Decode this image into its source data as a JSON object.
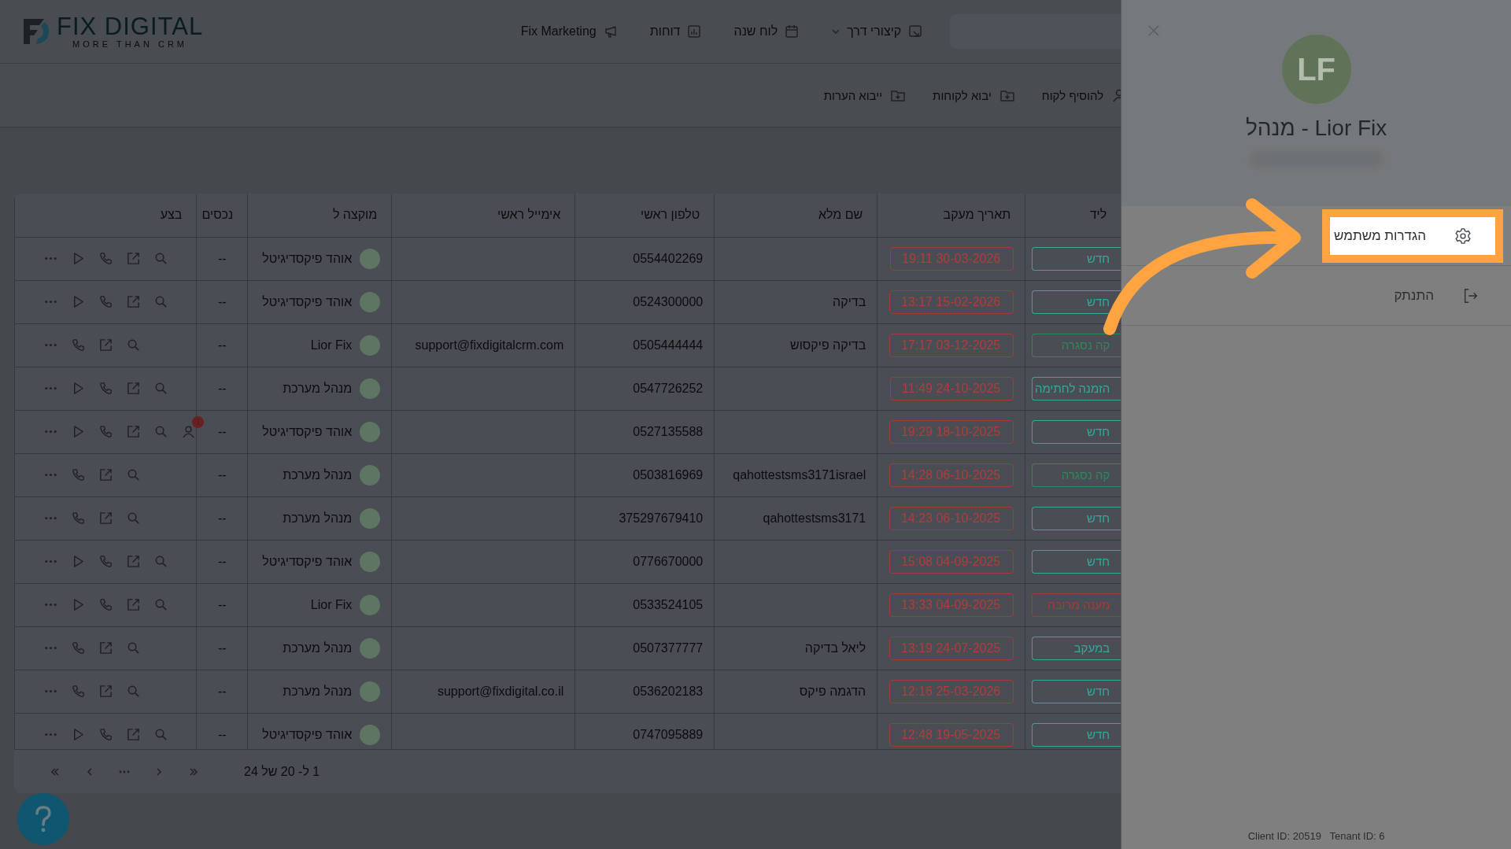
{
  "header": {
    "logo": {
      "name": "FIX DIGITAL",
      "tagline": "MORE THAN CRM"
    },
    "nav": [
      {
        "label": "קיצורי דרך",
        "kind": "dropdown"
      },
      {
        "label": "לוח שנה",
        "kind": "link"
      },
      {
        "label": "דוחות",
        "kind": "link"
      },
      {
        "label": "Fix Marketing",
        "kind": "link"
      }
    ]
  },
  "toolbar": [
    "להוסיף לקוח",
    "יבוא לקוחות",
    "ייבוא הערות"
  ],
  "table": {
    "columns": [
      "ליד",
      "תאריך מעקב",
      "שם מלא",
      "טלפון ראשי",
      "אימייל ראשי",
      "מוקצה ל",
      "נכסים",
      "בצע"
    ],
    "rows": [
      {
        "lead": {
          "text": "חדש",
          "color": "#33a89c"
        },
        "followup": "19:11 30-03-2026",
        "name": "",
        "phone": "0554402269",
        "email": "",
        "assigned": "אוהד פיקסדיגיטל",
        "assets": "--",
        "play": true
      },
      {
        "lead": {
          "text": "חדש",
          "color": "#33a89c"
        },
        "followup": "13:17 15-02-2026",
        "name": "בדיקה",
        "phone": "0524300000",
        "email": "",
        "assigned": "אוהד פיקסדיגיטל",
        "assets": "--",
        "play": true
      },
      {
        "lead": {
          "text": "קה נסגרה",
          "color": "#2b8a5c"
        },
        "followup": "17:17 03-12-2025",
        "name": "בדיקה פיקסוש",
        "phone": "0505444444",
        "email": "support@fixdigitalcrm.com",
        "assigned": "Lior Fix",
        "assets": "--",
        "play": false
      },
      {
        "lead": {
          "text": "הזמנה לחתימה",
          "color": "#33a89c"
        },
        "followup": "11:49 24-10-2025",
        "name": "",
        "phone": "0547726252",
        "email": "",
        "assigned": "מנהל מערכת",
        "assets": "--",
        "play": true
      },
      {
        "lead": {
          "text": "חדש",
          "color": "#33a89c"
        },
        "followup": "19:29 18-10-2025",
        "name": "",
        "phone": "0527135588",
        "email": "",
        "assigned": "אוהד פיקסדיגיטל",
        "assets": "--",
        "play": true,
        "alert": "1"
      },
      {
        "lead": {
          "text": "קה נסגרה",
          "color": "#2b8a5c"
        },
        "followup": "14:28 06-10-2025",
        "name": "qahottestsms3171israel",
        "phone": "0503816969",
        "email": "",
        "assigned": "מנהל מערכת",
        "assets": "--",
        "play": false
      },
      {
        "lead": {
          "text": "חדש",
          "color": "#33a89c"
        },
        "followup": "14:23 06-10-2025",
        "name": "qahottestsms3171",
        "phone": "375297679410",
        "email": "",
        "assigned": "מנהל מערכת",
        "assets": "--",
        "play": false
      },
      {
        "lead": {
          "text": "חדש",
          "color": "#33a89c"
        },
        "followup": "15:08 04-09-2025",
        "name": "",
        "phone": "0776670000",
        "email": "",
        "assigned": "אוהד פיקסדיגיטל",
        "assets": "--",
        "play": true
      },
      {
        "lead": {
          "text": "מענה מרובה",
          "color": "#a83a3a"
        },
        "followup": "13:33 04-09-2025",
        "name": "",
        "phone": "0533524105",
        "email": "",
        "assigned": "Lior Fix",
        "assets": "--",
        "play": true
      },
      {
        "lead": {
          "text": "במעקב",
          "color": "#33a89c"
        },
        "followup": "13:19 24-07-2025",
        "name": "ליאל בדיקה",
        "phone": "0507377777",
        "email": "",
        "assigned": "מנהל מערכת",
        "assets": "--",
        "play": false
      },
      {
        "lead": {
          "text": "חדש",
          "color": "#33a89c"
        },
        "followup": "12:16 25-03-2026",
        "name": "הדגמה פיקס",
        "phone": "0536202183",
        "email": "support@fixdigital.co.il",
        "assigned": "מנהל מערכת",
        "assets": "--",
        "play": false
      },
      {
        "lead": {
          "text": "חדש",
          "color": "#33a89c"
        },
        "followup": "12:48 19-05-2025",
        "name": "",
        "phone": "0747095889",
        "email": "",
        "assigned": "אוהד פיקסדיגיטל",
        "assets": "--",
        "play": true
      }
    ],
    "pagination": "1 ל- 20 של 24"
  },
  "panel": {
    "initials": "LF",
    "user_name": "Lior Fix - מנהל",
    "menu": [
      {
        "label": "הגדרות משתמש",
        "highlighted": true
      },
      {
        "label": "התנתק",
        "highlighted": false
      }
    ],
    "footer": "Client ID: 20519   Tenant ID: 6"
  }
}
